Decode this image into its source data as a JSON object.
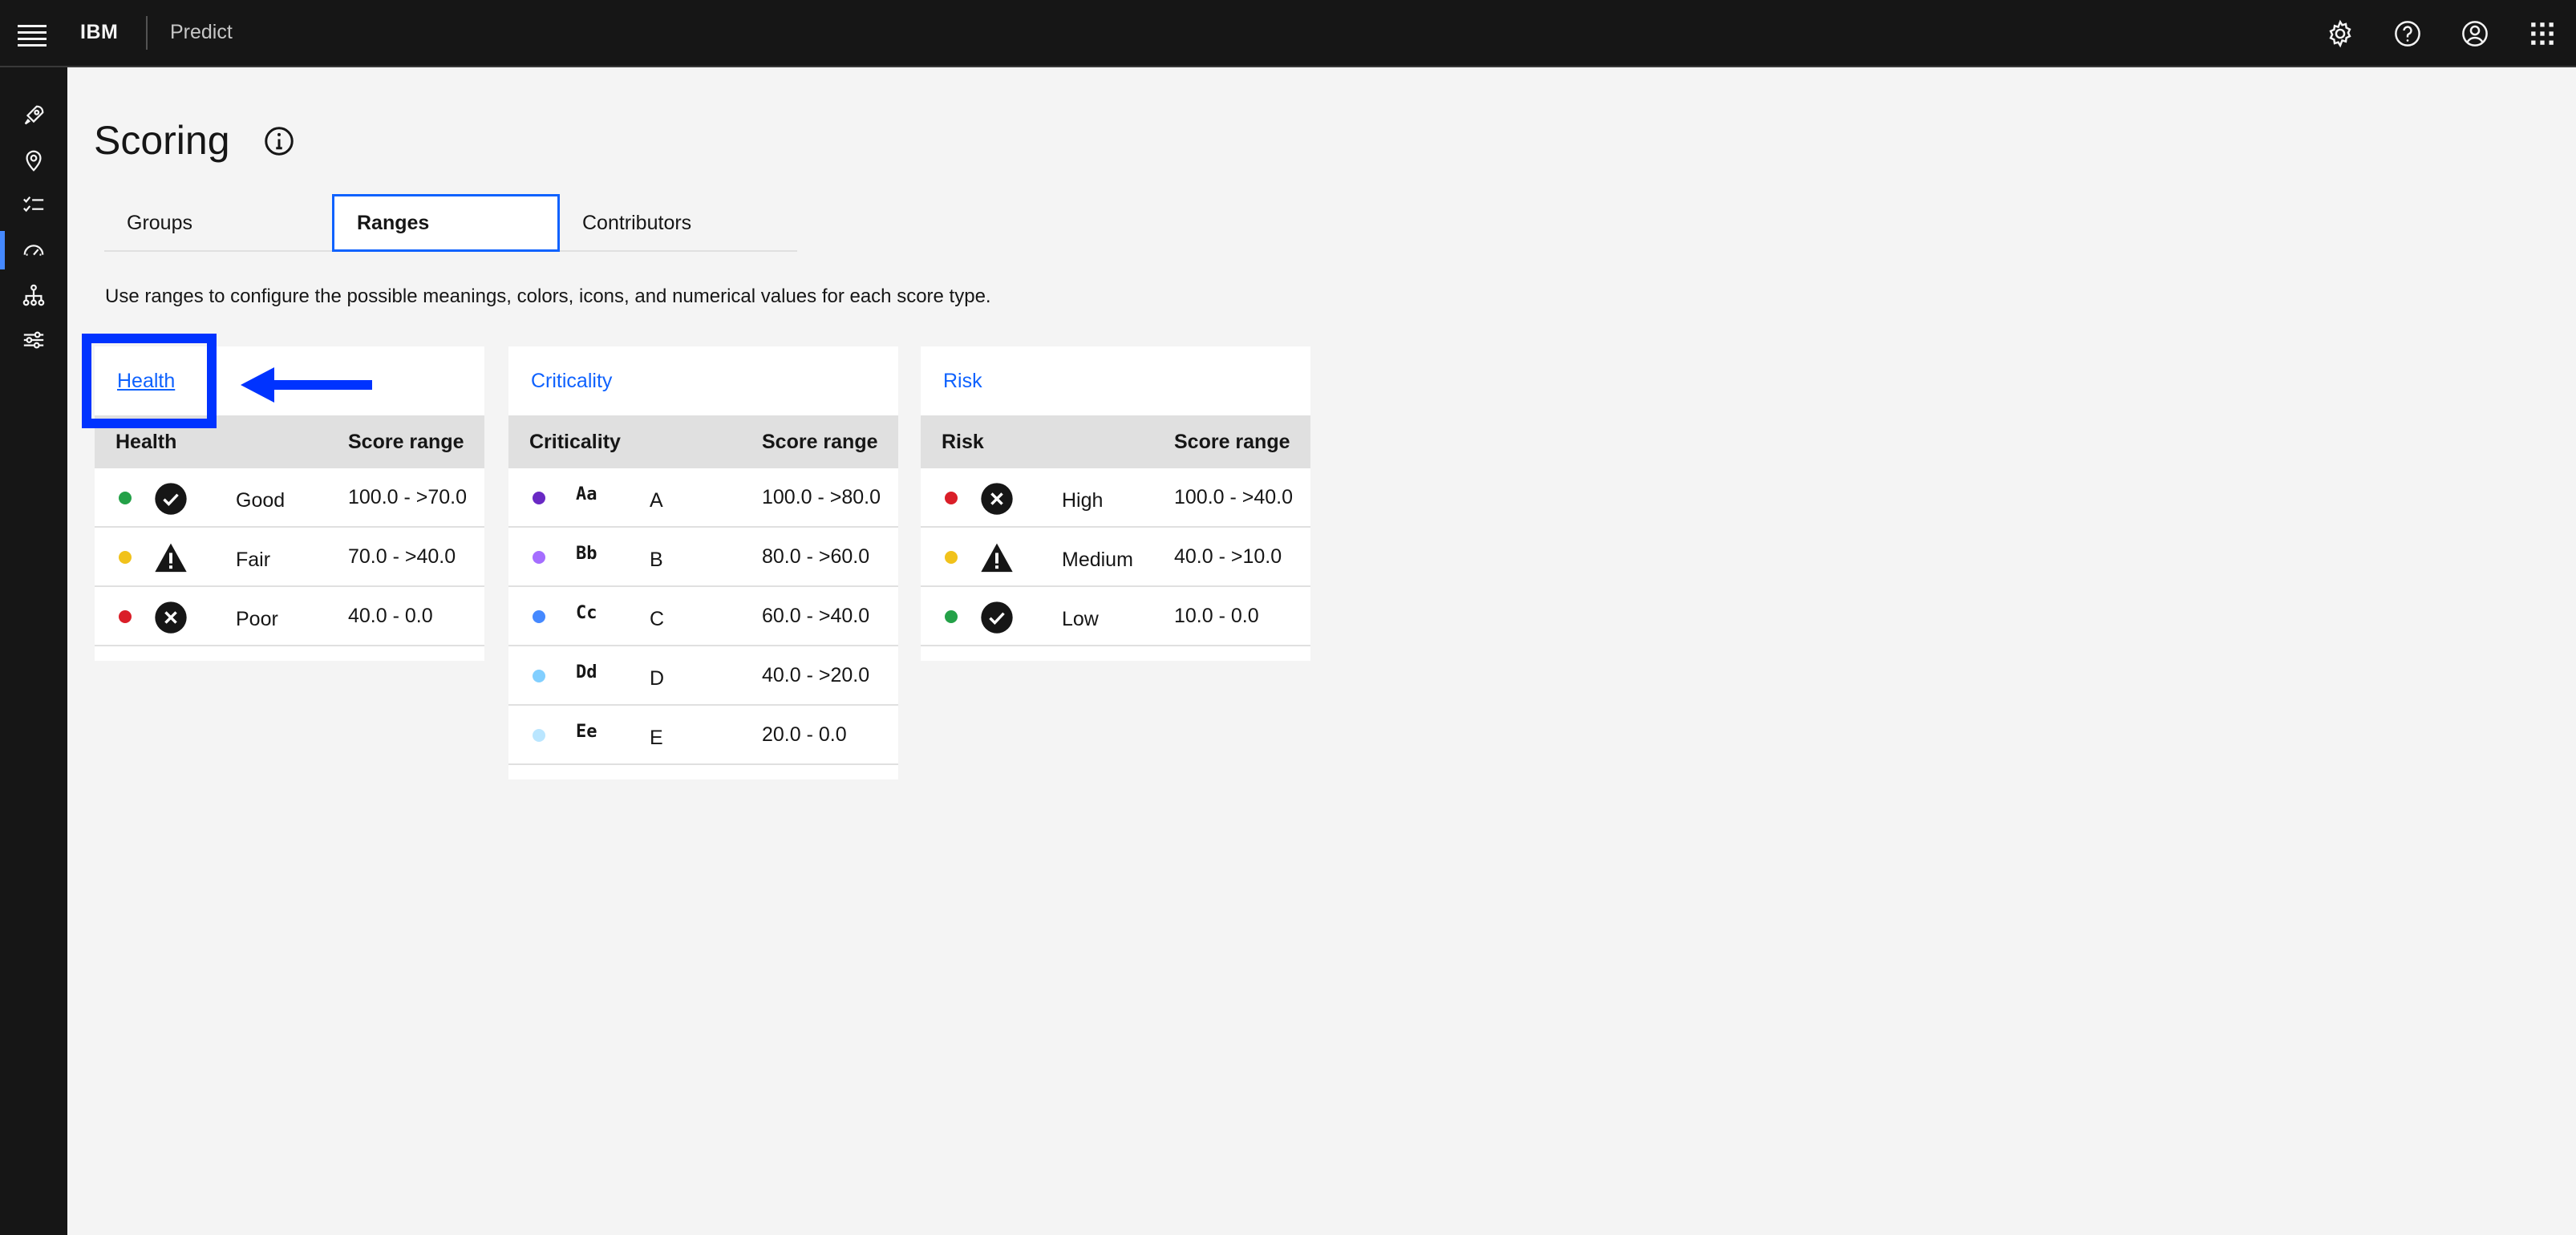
{
  "header": {
    "brand": "IBM",
    "product": "Predict"
  },
  "page": {
    "title": "Scoring",
    "description": "Use ranges to configure the possible meanings, colors, icons, and numerical values for each score type."
  },
  "tabs": [
    {
      "label": "Groups",
      "selected": false
    },
    {
      "label": "Ranges",
      "selected": true
    },
    {
      "label": "Contributors",
      "selected": false
    }
  ],
  "cards": {
    "health": {
      "title": "Health",
      "col1": "Health",
      "col2": "Score range",
      "rows": [
        {
          "color": "#24a148",
          "icon": "checkmark-filled-icon",
          "meaning": "Good",
          "range": "100.0 - >70.0"
        },
        {
          "color": "#f1c21b",
          "icon": "warning-triangle-icon",
          "meaning": "Fair",
          "range": "70.0 - >40.0"
        },
        {
          "color": "#da1e28",
          "icon": "close-filled-icon",
          "meaning": "Poor",
          "range": "40.0 - 0.0"
        }
      ]
    },
    "criticality": {
      "title": "Criticality",
      "col1": "Criticality",
      "col2": "Score range",
      "rows": [
        {
          "color": "#6929c4",
          "icon": "Aa",
          "meaning": "A",
          "range": "100.0 - >80.0"
        },
        {
          "color": "#a56eff",
          "icon": "Bb",
          "meaning": "B",
          "range": "80.0 - >60.0"
        },
        {
          "color": "#4589ff",
          "icon": "Cc",
          "meaning": "C",
          "range": "60.0 - >40.0"
        },
        {
          "color": "#82cfff",
          "icon": "Dd",
          "meaning": "D",
          "range": "40.0 - >20.0"
        },
        {
          "color": "#bae6ff",
          "icon": "Ee",
          "meaning": "E",
          "range": "20.0 - 0.0"
        }
      ]
    },
    "risk": {
      "title": "Risk",
      "col1": "Risk",
      "col2": "Score range",
      "rows": [
        {
          "color": "#da1e28",
          "icon": "close-filled-icon",
          "meaning": "High",
          "range": "100.0 - >40.0"
        },
        {
          "color": "#f1c21b",
          "icon": "warning-triangle-icon",
          "meaning": "Medium",
          "range": "40.0 - >10.0"
        },
        {
          "color": "#24a148",
          "icon": "checkmark-filled-icon",
          "meaning": "Low",
          "range": "10.0 - 0.0"
        }
      ]
    }
  },
  "annotation": {
    "color": "#0033ff"
  }
}
